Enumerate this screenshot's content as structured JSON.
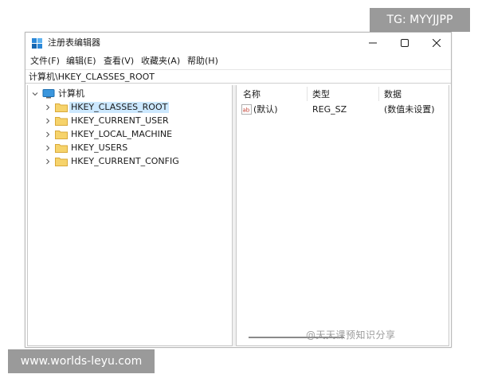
{
  "watermarks": {
    "top": "TG: MYYJJPP",
    "bottom": "www.worlds-leyu.com",
    "inner": "@天天课预知识分享"
  },
  "window": {
    "title": "注册表编辑器",
    "app_icon": "registry-editor-icon",
    "controls": [
      "minimize-icon",
      "maximize-icon",
      "close-icon"
    ]
  },
  "menu": {
    "items": [
      {
        "label": "文件(F)"
      },
      {
        "label": "编辑(E)"
      },
      {
        "label": "查看(V)"
      },
      {
        "label": "收藏夹(A)"
      },
      {
        "label": "帮助(H)"
      }
    ]
  },
  "address": {
    "path": "计算机\\HKEY_CLASSES_ROOT"
  },
  "tree": {
    "root": {
      "label": "计算机",
      "icon": "computer-icon",
      "expanded": true
    },
    "children": [
      {
        "label": "HKEY_CLASSES_ROOT",
        "icon": "folder-icon",
        "selected": true
      },
      {
        "label": "HKEY_CURRENT_USER",
        "icon": "folder-icon"
      },
      {
        "label": "HKEY_LOCAL_MACHINE",
        "icon": "folder-icon"
      },
      {
        "label": "HKEY_USERS",
        "icon": "folder-icon"
      },
      {
        "label": "HKEY_CURRENT_CONFIG",
        "icon": "folder-icon"
      }
    ]
  },
  "list": {
    "columns": [
      "名称",
      "类型",
      "数据"
    ],
    "rows": [
      {
        "name": "(默认)",
        "type": "REG_SZ",
        "data": "(数值未设置)",
        "icon": "string-value-icon"
      }
    ]
  },
  "colors": {
    "selection": "#cce8ff",
    "folder": "#f6d36b",
    "watermark_bg": "#9a9a9a"
  }
}
